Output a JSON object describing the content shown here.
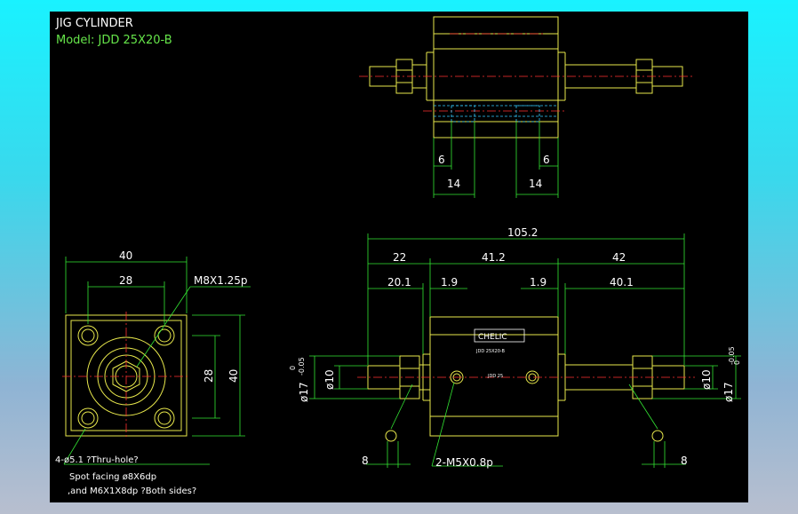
{
  "header": {
    "title": "JIG CYLINDER",
    "model": "Model: JDD 25X20-B"
  },
  "dims": {
    "top_left_6": "6",
    "top_right_6": "6",
    "top_left_14": "14",
    "top_right_14": "14",
    "overall": "105.2",
    "seg_22": "22",
    "seg_41_2": "41.2",
    "seg_42": "42",
    "seg_20_1": "20.1",
    "seg_1_9_left": "1.9",
    "seg_1_9_right": "1.9",
    "seg_40_1": "40.1",
    "end_40": "40",
    "end_28_h": "28",
    "end_28_v": "28",
    "end_40_v": "40",
    "thread_label": "M8X1.25p",
    "dia_10_left": "ø10",
    "dia_17_left": "ø17",
    "tol_left_top": "0",
    "tol_left_bot": "-0.05",
    "dia_10_right": "ø10",
    "dia_17_right": "ø17",
    "tol_right_top": "0",
    "tol_right_bot": "-0.05",
    "bottom_8_left": "8",
    "bottom_8_right": "8",
    "port_label": "2-M5X0.8p"
  },
  "notes": {
    "line1": "4-ø5.1 ?Thru-hole?",
    "line2": "Spot facing  ø8X6dp",
    "line3": ",and M6X1X8dp ?Both sides?"
  },
  "nameplate": {
    "brand": "CHELIC",
    "model_small": "JDD 25",
    "fine_print": "JDD 25X20-B"
  }
}
